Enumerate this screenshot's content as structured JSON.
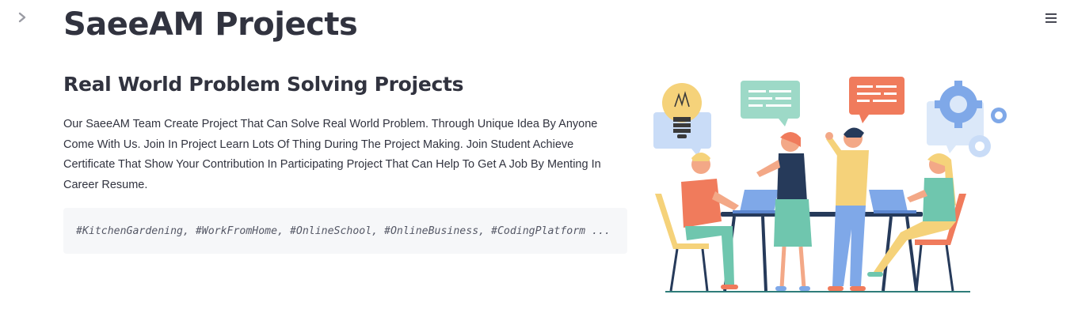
{
  "app": {
    "title": "SaeeAM Projects"
  },
  "icons": {
    "sidebar_toggle": "chevron-right-icon",
    "menu": "hamburger-menu-icon"
  },
  "main": {
    "heading": "Real World Problem Solving Projects",
    "description": "Our SaeeAM Team Create Project That Can Solve Real World Problem. Through Unique Idea By Anyone Come With Us. Join In Project Learn Lots Of Thing During The Project Making. Join Student Achieve Certificate That Show Your Contribution In Participating Project That Can Help To Get A Job By Menting In Career Resume.",
    "tags_code": "#KitchenGardening, #WorkFromHome, #OnlineSchool, #OnlineBusiness, #CodingPlatform ..."
  },
  "colors": {
    "text": "#31333f",
    "code_bg": "#f6f7f9",
    "orange": "#f07b5c",
    "teal": "#8fd3c2",
    "blue_light": "#c9dcf7",
    "yellow": "#f5d27a",
    "navy": "#263a5a"
  }
}
